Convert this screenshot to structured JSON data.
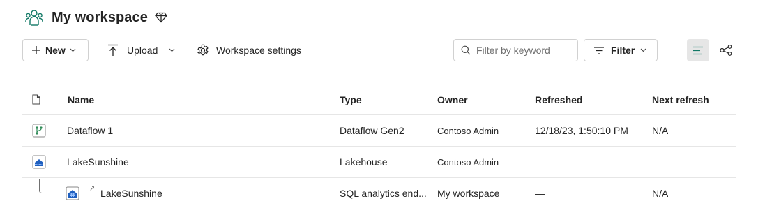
{
  "workspace": {
    "title": "My workspace",
    "icon": "workspace-people-icon",
    "premium_icon": "diamond-icon"
  },
  "toolbar": {
    "new_label": "New",
    "upload_label": "Upload",
    "settings_label": "Workspace settings",
    "search_placeholder": "Filter by keyword",
    "filter_label": "Filter"
  },
  "table": {
    "columns": [
      "Name",
      "Type",
      "Owner",
      "Refreshed",
      "Next refresh"
    ],
    "rows": [
      {
        "name": "Dataflow 1",
        "type": "Dataflow Gen2",
        "owner": "Contoso Admin",
        "refreshed": "12/18/23, 1:50:10 PM",
        "next_refresh": "N/A",
        "icon": "dataflow-icon"
      },
      {
        "name": "LakeSunshine",
        "type": "Lakehouse",
        "owner": "Contoso Admin",
        "refreshed": "—",
        "next_refresh": "—",
        "icon": "lakehouse-icon"
      },
      {
        "name": "LakeSunshine",
        "type": "SQL analytics end...",
        "owner": "My workspace",
        "refreshed": "—",
        "next_refresh": "N/A",
        "icon": "sql-endpoint-icon"
      }
    ]
  },
  "colors": {
    "accent": "#117865",
    "border": "#d1d1d1",
    "text": "#242424",
    "muted": "#707070"
  }
}
